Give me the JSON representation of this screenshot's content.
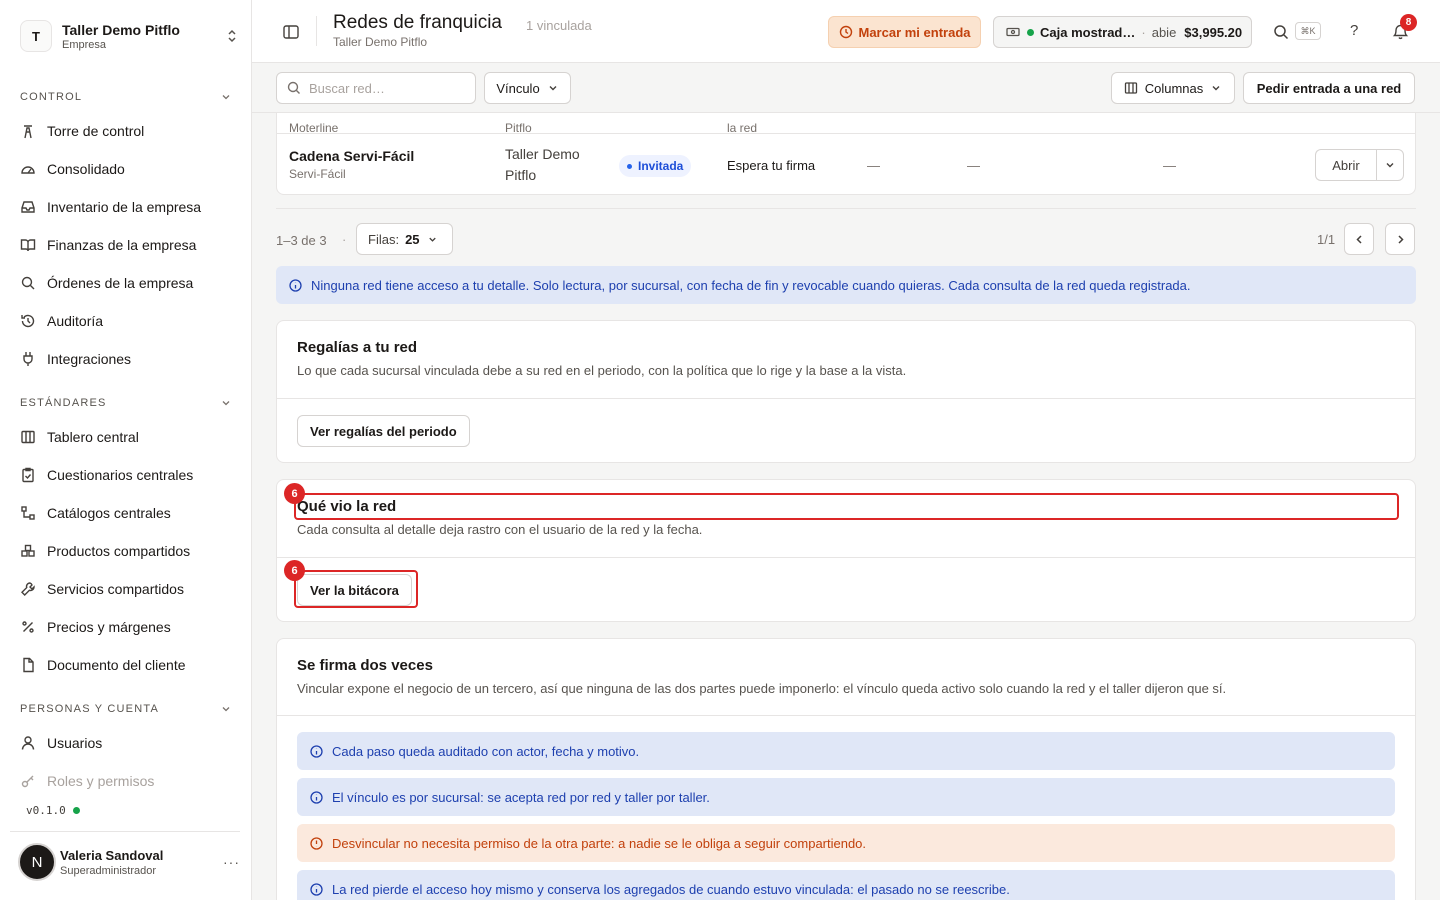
{
  "sidebar": {
    "brand_initial": "T",
    "brand_name": "Taller Demo Pitflo",
    "brand_sub": "Empresa",
    "sections": [
      {
        "title": "CONTROL",
        "items": [
          "Torre de control",
          "Consolidado",
          "Inventario de la empresa",
          "Finanzas de la empresa",
          "Órdenes de la empresa",
          "Auditoría",
          "Integraciones"
        ]
      },
      {
        "title": "ESTÁNDARES",
        "items": [
          "Tablero central",
          "Cuestionarios centrales",
          "Catálogos centrales",
          "Productos compartidos",
          "Servicios compartidos",
          "Precios y márgenes",
          "Documento del cliente"
        ]
      },
      {
        "title": "PERSONAS Y CUENTA",
        "items": [
          "Usuarios",
          "Roles y permisos"
        ]
      }
    ],
    "version": "v0.1.0",
    "user": {
      "initial": "N",
      "name": "Valeria Sandoval",
      "role": "Superadministrador",
      "more": "···"
    }
  },
  "header": {
    "title": "Redes de franquicia",
    "count": "1 vinculada",
    "subtitle": "Taller Demo Pitflo",
    "entry_label": "Marcar mi entrada",
    "caja": {
      "name": "Caja mostrad…",
      "sep": "·",
      "state": "abie",
      "amount": "$3,995.20"
    },
    "kbd": "⌘K",
    "help": "?",
    "notifications": "8"
  },
  "toolbar": {
    "search_placeholder": "Buscar red…",
    "vinculo_label": "Vínculo",
    "columns_label": "Columnas",
    "request_label": "Pedir entrada a una red"
  },
  "table": {
    "ghost": [
      "Moterline",
      "Pitflo",
      "la red"
    ],
    "row": {
      "name": "Cadena Servi-Fácil",
      "sub": "Servi-Fácil",
      "org": "Taller Demo Pitflo",
      "badge": "Invitada",
      "state": "Espera tu firma",
      "dash": "—",
      "open": "Abrir"
    }
  },
  "pagination": {
    "count": "1–3 de 3",
    "dot": "·",
    "rows_label": "Filas:",
    "rows_value": "25",
    "page": "1/1"
  },
  "privacy_alert": "Ninguna red tiene acceso a tu detalle. Solo lectura, por sucursal, con fecha de fin y revocable cuando quieras. Cada consulta de la red queda registrada.",
  "royalties": {
    "title": "Regalías a tu red",
    "desc": "Lo que cada sucursal vinculada debe a su red en el periodo, con la política que lo rige y la base a la vista.",
    "button": "Ver regalías del periodo"
  },
  "log": {
    "title": "Qué vio la red",
    "desc": "Cada consulta al detalle deja rastro con el usuario de la red y la fecha.",
    "button": "Ver la bitácora",
    "marker": "6"
  },
  "signature": {
    "title": "Se firma dos veces",
    "desc": "Vincular expone el negocio de un tercero, así que ninguna de las dos partes puede imponerlo: el vínculo queda activo solo cuando la red y el taller dijeron que sí.",
    "notes": [
      {
        "kind": "info",
        "text": "Cada paso queda auditado con actor, fecha y motivo."
      },
      {
        "kind": "info",
        "text": "El vínculo es por sucursal: se acepta red por red y taller por taller."
      },
      {
        "kind": "warning",
        "text": "Desvincular no necesita permiso de la otra parte: a nadie se le obliga a seguir compartiendo."
      },
      {
        "kind": "info",
        "text": "La red pierde el acceso hoy mismo y conserva los agregados de cuando estuvo vinculada: el pasado no se reescribe."
      }
    ]
  },
  "colors": {
    "accent_orange": "#c2410c",
    "info_blue": "#1e40af",
    "status_green": "#16a34a",
    "highlight_red": "#dc2626"
  }
}
